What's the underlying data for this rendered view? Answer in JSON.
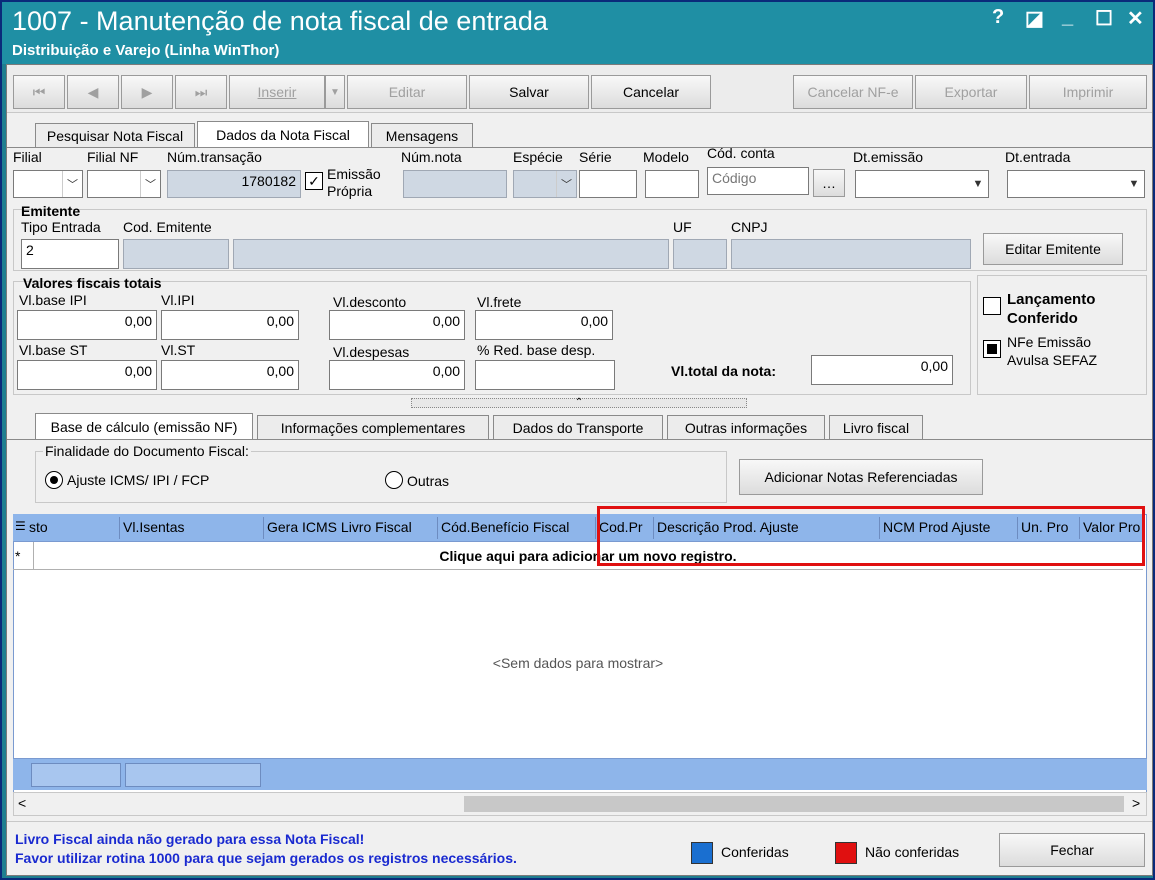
{
  "window": {
    "title": "1007 - Manutenção de nota fiscal de entrada",
    "subtitle": "Distribuição e Varejo (Linha WinThor)",
    "controls": [
      "?",
      "◪",
      "_",
      "☐",
      "✕"
    ]
  },
  "toolbar": {
    "first": "⏮",
    "prev": "◀",
    "next": "▶",
    "last": "⏭",
    "inserir": "Inserir",
    "editar": "Editar",
    "salvar": "Salvar",
    "cancelar": "Cancelar",
    "cancelar_nfe": "Cancelar NF-e",
    "exportar": "Exportar",
    "imprimir": "Imprimir"
  },
  "top_tabs": [
    "Pesquisar Nota Fiscal",
    "Dados da Nota Fiscal",
    "Mensagens"
  ],
  "header_fields": {
    "filial_label": "Filial",
    "filial_nf_label": "Filial NF",
    "num_transacao_label": "Núm.transação",
    "num_transacao_value": "1780182",
    "emissao_propria_label1": "Emissão",
    "emissao_propria_label2": "Própria",
    "num_nota_label": "Núm.nota",
    "especie_label": "Espécie",
    "serie_label": "Série",
    "modelo_label": "Modelo",
    "cod_conta_label": "Cód. conta",
    "cod_conta_placeholder": "Código",
    "dt_emissao_label": "Dt.emissão",
    "dt_entrada_label": "Dt.entrada"
  },
  "emitente": {
    "section_label": "Emitente",
    "tipo_entrada_label": "Tipo Entrada",
    "tipo_entrada_value": "2",
    "cod_emitente_label": "Cod. Emitente",
    "uf_label": "UF",
    "cnpj_label": "CNPJ",
    "editar_button": "Editar Emitente"
  },
  "valores": {
    "section_label": "Valores fiscais totais",
    "vl_base_ipi_label": "Vl.base IPI",
    "vl_base_ipi": "0,00",
    "vl_ipi_label": "Vl.IPI",
    "vl_ipi": "0,00",
    "vl_desconto_label": "Vl.desconto",
    "vl_desconto": "0,00",
    "vl_frete_label": "Vl.frete",
    "vl_frete": "0,00",
    "vl_base_st_label": "Vl.base ST",
    "vl_base_st": "0,00",
    "vl_st_label": "Vl.ST",
    "vl_st": "0,00",
    "vl_despesas_label": "Vl.despesas",
    "vl_despesas": "0,00",
    "red_base_label": "% Red. base desp.",
    "vl_total_label": "Vl.total da nota:",
    "vl_total": "0,00"
  },
  "side_checks": {
    "lancamento_line1": "Lançamento",
    "lancamento_line2": "Conferido",
    "nfe_line1": "NFe Emissão",
    "nfe_line2": "Avulsa SEFAZ"
  },
  "lower_tabs": [
    "Base de cálculo (emissão NF)",
    "Informações complementares",
    "Dados do Transporte",
    "Outras informações",
    "Livro fiscal"
  ],
  "finalidade": {
    "label": "Finalidade do Documento Fiscal:",
    "opt1": "Ajuste ICMS/ IPI / FCP",
    "opt2": "Outras",
    "selected": "Ajuste ICMS/ IPI / FCP"
  },
  "add_notas_button": "Adicionar Notas Referenciadas",
  "grid": {
    "columns": [
      "sto",
      "Vl.Isentas",
      "Gera ICMS Livro Fiscal",
      "Cód.Benefício Fiscal",
      "Cod.Pr",
      "Descrição Prod. Ajuste",
      "NCM Prod Ajuste",
      "Un. Pro",
      "Valor Pro"
    ],
    "new_row_marker": "*",
    "new_row_text": "Clique aqui para adicionar um novo registro.",
    "empty_text": "<Sem dados para mostrar>"
  },
  "footer": {
    "msg1": "Livro Fiscal ainda não gerado para essa Nota Fiscal!",
    "msg2": "Favor utilizar rotina 1000 para que sejam gerados os registros necessários.",
    "legend_conferidas": "Conferidas",
    "legend_nao": "Não conferidas",
    "fechar": "Fechar"
  },
  "colors": {
    "accent_title": "#1f8fa4",
    "conferidas": "#1a6fd0",
    "nao_conferidas": "#e01010",
    "highlight": "#e01010"
  }
}
